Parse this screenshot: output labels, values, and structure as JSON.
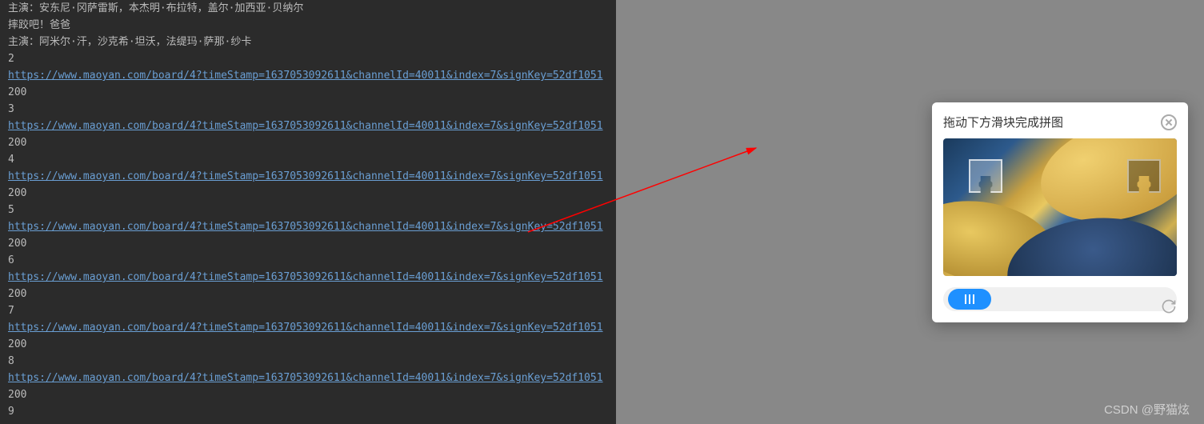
{
  "console": {
    "cast_label": "主演：",
    "line1_cast": "安东尼·冈萨雷斯，本杰明·布拉特，盖尔·加西亚·贝纳尔",
    "movie_title": "摔跤吧！爸爸",
    "line2_cast": "阿米尔·汗，沙克希·坦沃，法缇玛·萨那·纱卡",
    "url": "https://www.maoyan.com/board/4?timeStamp=1637053092611&channelId=40011&index=7&signKey=52df1051",
    "status_code": "200",
    "indices": [
      "2",
      "3",
      "4",
      "5",
      "6",
      "7",
      "8",
      "9"
    ]
  },
  "captcha": {
    "title": "拖动下方滑块完成拼图"
  },
  "watermark": "CSDN @野猫炫"
}
